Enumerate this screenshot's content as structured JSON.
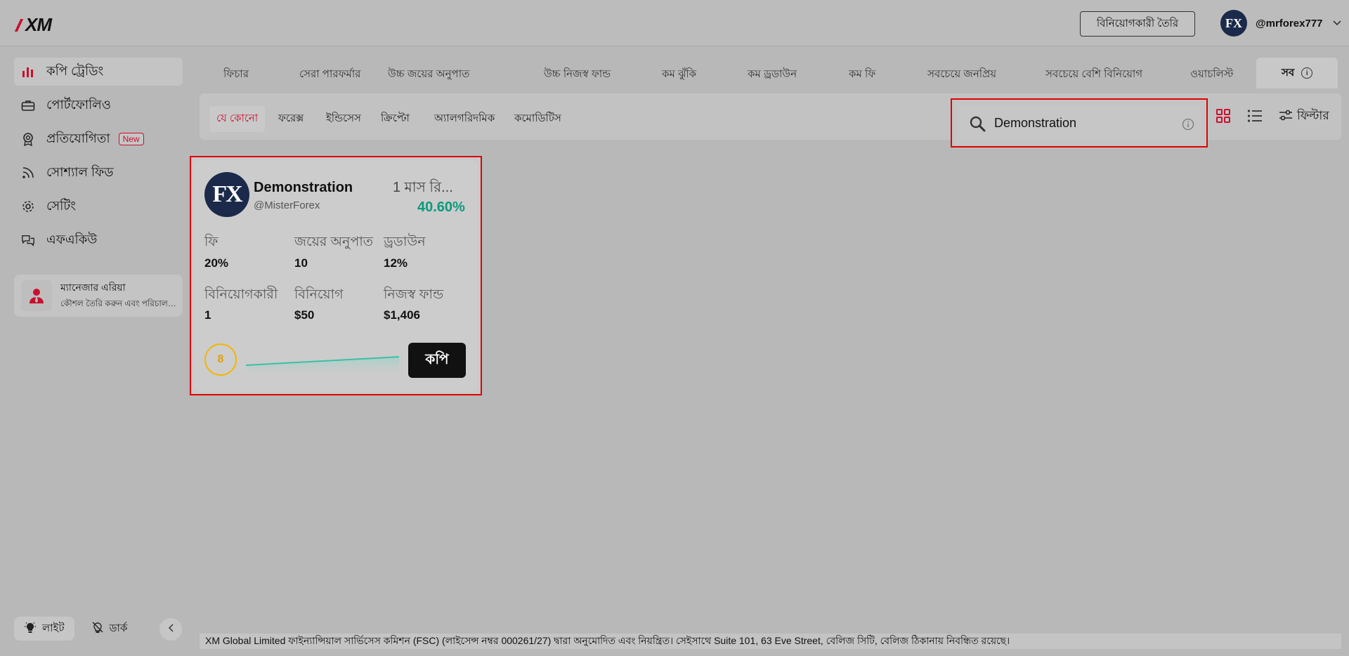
{
  "header": {
    "logo": "XM",
    "create_investor_label": "বিনিয়োগকারী তৈরি",
    "avatar_text": "FX",
    "username": "@mrforex777"
  },
  "sidebar": {
    "items": [
      {
        "label": "কপি ট্রেডিং"
      },
      {
        "label": "পোর্টফোলিও"
      },
      {
        "label": "প্রতিযোগিতা",
        "badge": "New"
      },
      {
        "label": "সোশ্যাল ফিড"
      },
      {
        "label": "সেটিং"
      },
      {
        "label": "এফএকিউ"
      }
    ],
    "manager": {
      "title": "ম্যানেজার এরিয়া",
      "subtitle": "কৌশল তৈরি করুন এবং পরিচালনা করুন"
    },
    "theme": {
      "light": "লাইট",
      "dark": "ডার্ক"
    }
  },
  "tabs": [
    "ফিচার",
    "সেরা পারফর্মার",
    "উচ্চ জয়ের অনুপাত",
    "উচ্চ নিজস্ব ফান্ড",
    "কম ঝুঁকি",
    "কম ড্রডাউন",
    "কম ফি",
    "সবচেয়ে জনপ্রিয়",
    "সবচেয়ে বেশি বিনিয়োগ",
    "ওয়াচলিস্ট",
    "সব"
  ],
  "categories": [
    "যে কোনো",
    "ফরেক্স",
    "ইন্ডিসেস",
    "ক্রিপ্টো",
    "অ্যালগরিদমিক",
    "কমোডিটিস"
  ],
  "search": {
    "value": "Demonstration"
  },
  "filter_label": "ফিল্টার",
  "card": {
    "avatar_text": "FX",
    "name": "Demonstration",
    "handle": "@MisterForex",
    "period": "1 মাস রি...",
    "return": "40.60%",
    "stats": [
      {
        "label": "ফি",
        "value": "20%"
      },
      {
        "label": "জয়ের অনুপাত",
        "value": "10"
      },
      {
        "label": "ড্রডাউন",
        "value": "12%"
      },
      {
        "label": "বিনিয়োগকারী",
        "value": "1"
      },
      {
        "label": "বিনিয়োগ",
        "value": "$50"
      },
      {
        "label": "নিজস্ব ফান্ড",
        "value": "$1,406"
      }
    ],
    "risk_score": "8",
    "copy_label": "কপি"
  },
  "footer": "XM Global Limited ফাইন্যান্সিয়াল সার্ভিসেস কমিশন (FSC) (লাইসেন্স নম্বর 000261/27) দ্বারা অনুমোদিত এবং নিয়ন্ত্রিত। সেইসাথে Suite 101, 63 Eve Street, বেলিজ সিটি, বেলিজ ঠিকানায় নিবন্ধিত রয়েছে।",
  "colors": {
    "accent": "#c8102e",
    "positive": "#0a9a7e",
    "risk": "#f2b600"
  }
}
